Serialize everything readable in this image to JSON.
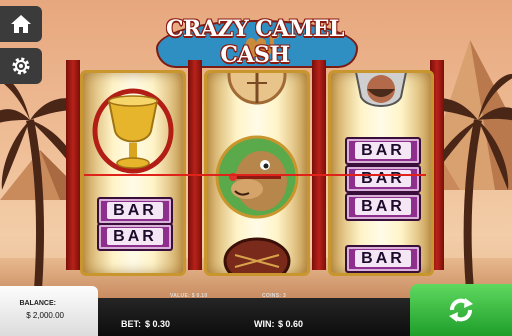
{
  "game": {
    "title": "CRAZY CAMEL CASH"
  },
  "nav": {
    "home_icon": "home-icon",
    "settings_icon": "gear-icon"
  },
  "reels": {
    "reel1": [
      "Golden Cup",
      "BAR",
      "BAR"
    ],
    "reel2": [
      "Sign",
      "Camel",
      "Saddle"
    ],
    "reel3": [
      "Camel Rider",
      "BAR",
      "BAR",
      "BAR",
      "BAR"
    ],
    "bar_label": "BAR"
  },
  "stats": {
    "balance_label": "BALANCE:",
    "balance_value": "$ 2,000.00",
    "value_label": "VALUE: $ 0.10",
    "coins_label": "COINS: 3",
    "bet_label": "BET:",
    "bet_value": "$ 0.30",
    "win_label": "WIN:",
    "win_value": "$ 0.60"
  },
  "colors": {
    "payline": "#e0231a",
    "spin": "#2cb23a",
    "bar_symbol": "#8e2f8e"
  },
  "spin_icon": "refresh-icon"
}
